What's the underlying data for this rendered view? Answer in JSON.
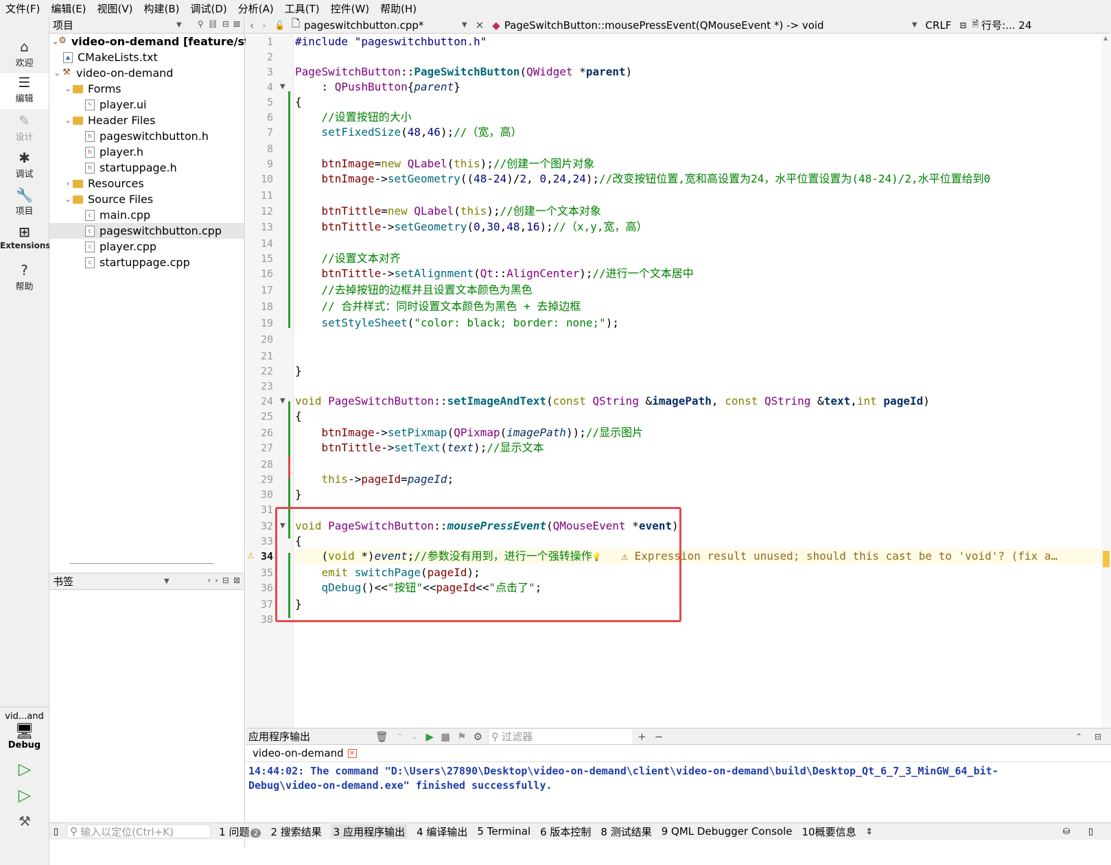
{
  "menubar": [
    "文件(F)",
    "编辑(E)",
    "视图(V)",
    "构建(B)",
    "调试(D)",
    "分析(A)",
    "工具(T)",
    "控件(W)",
    "帮助(H)"
  ],
  "modes": [
    {
      "label": "欢迎",
      "icon": "⌂"
    },
    {
      "label": "编辑",
      "icon": "☰"
    },
    {
      "label": "设计",
      "icon": "✎"
    },
    {
      "label": "调试",
      "icon": "✱"
    },
    {
      "label": "项目",
      "icon": "🔧"
    },
    {
      "label": "Extensions",
      "icon": "⊞"
    },
    {
      "label": "帮助",
      "icon": "?"
    }
  ],
  "kit": {
    "name": "vid...and",
    "build": "Debug"
  },
  "project_pane": {
    "title": "项目",
    "tree": [
      "video-on-demand [feature/startui",
      "CMakeLists.txt",
      "video-on-demand",
      "Forms",
      "player.ui",
      "Header Files",
      "pageswitchbutton.h",
      "player.h",
      "startuppage.h",
      "Resources",
      "Source Files",
      "main.cpp",
      "pageswitchbutton.cpp",
      "player.cpp",
      "startuppage.cpp"
    ]
  },
  "bookmarks": {
    "title": "书签"
  },
  "editor": {
    "file": "pageswitchbutton.cpp*",
    "symbol": "PageSwitchButton::mousePressEvent(QMouseEvent *) -> void",
    "line_ending": "CRLF",
    "position": "行号:... 24",
    "current_line": 34,
    "warning": "⚠ Expression result unused; should this cast be to 'void'? (fix a…"
  },
  "output_pane": {
    "title": "应用程序输出",
    "filter_placeholder": "过滤器",
    "tab": "video-on-demand",
    "line1": "14:44:02: The command \"D:\\Users\\27890\\Desktop\\video-on-demand\\client\\video-on-demand\\build\\Desktop_Qt_6_7_3_MinGW_64_bit-",
    "line2": "Debug\\video-on-demand.exe\" finished successfully."
  },
  "statusbar": {
    "locator_placeholder": "输入以定位(Ctrl+K)",
    "tabs": [
      "1 问题",
      "2 搜索结果",
      "3 应用程序输出",
      "4 编译输出",
      "5 Terminal",
      "6 版本控制",
      "8 测试结果",
      "9 QML Debugger Console",
      "10概要信息"
    ],
    "issues_count": "2"
  },
  "colors": {
    "accent_red_box": "#e8474a",
    "output_text": "#1f3da8",
    "run_green": "#2e9e3a"
  }
}
